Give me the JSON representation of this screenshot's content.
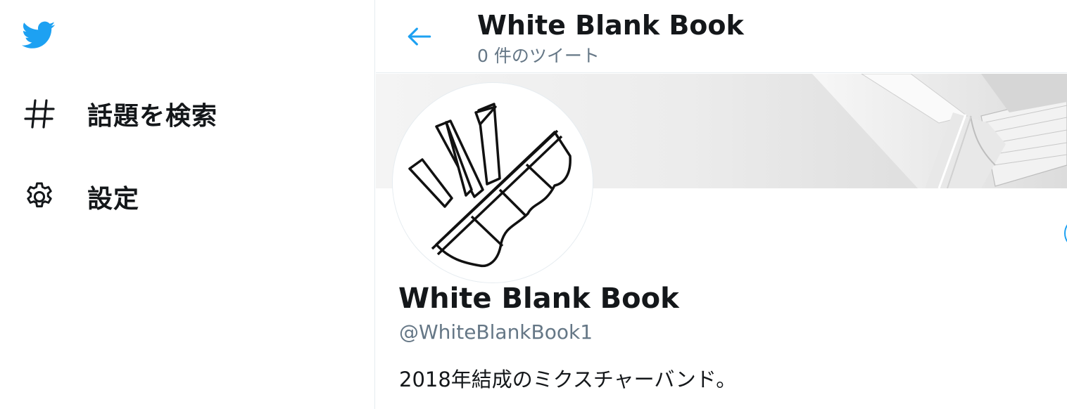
{
  "sidebar": {
    "logo_icon": "twitter-bird-icon",
    "items": [
      {
        "label": "話題を検索",
        "icon": "hashtag-icon"
      },
      {
        "label": "設定",
        "icon": "gear-icon"
      }
    ]
  },
  "header": {
    "back_icon": "arrow-left-icon",
    "title": "White Blank Book",
    "subtitle": "0 件のツイート"
  },
  "profile": {
    "name": "White Blank Book",
    "handle": "@WhiteBlankBook1",
    "bio": "2018年結成のミクスチャーバンド。"
  },
  "colors": {
    "accent": "#1da1f2",
    "text_primary": "#14171a",
    "text_secondary": "#657786",
    "border": "#e6ecf0"
  }
}
